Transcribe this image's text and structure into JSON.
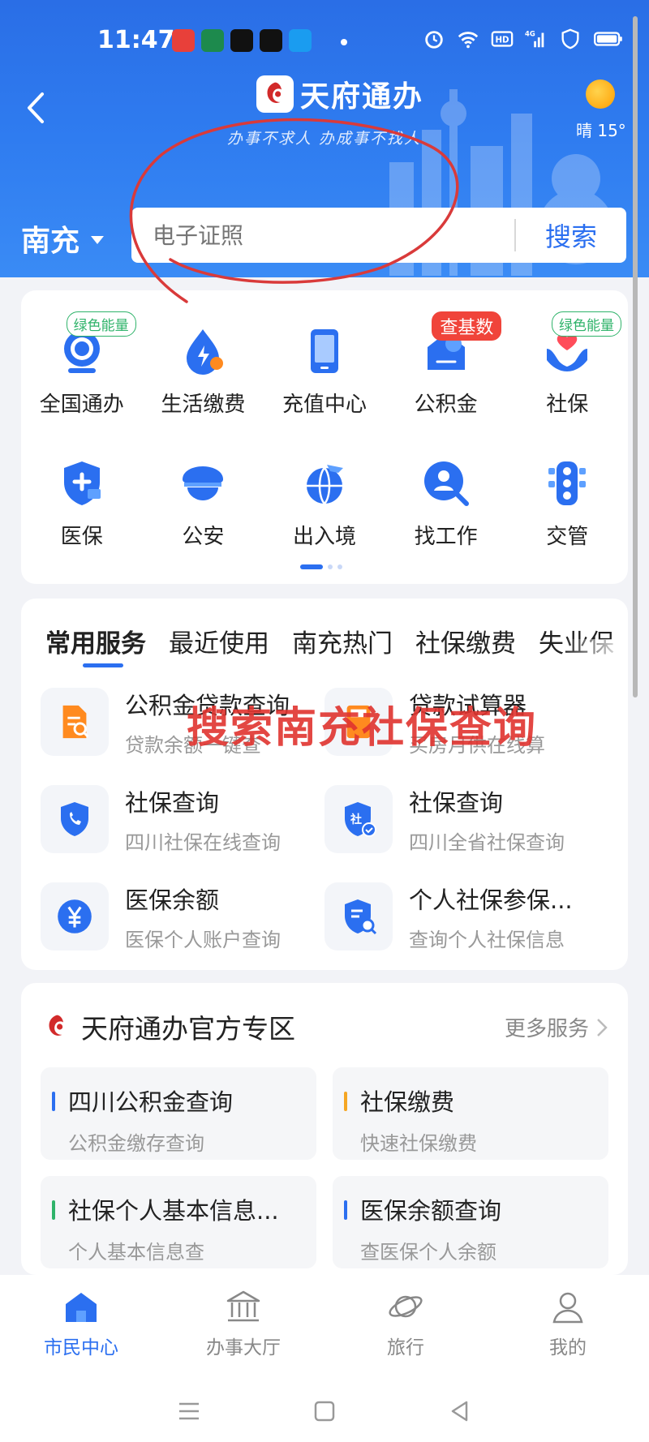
{
  "status_bar": {
    "time": "11:47",
    "network": "4G"
  },
  "header": {
    "logo_text": "天府通办",
    "slogan": "办事不求人 办成事不找人",
    "weather": "晴 15°",
    "city": "南充",
    "search_placeholder": "电子证照",
    "search_button": "搜索"
  },
  "grid": [
    {
      "label": "全国通办",
      "badge": "绿色能量",
      "badge_type": "green",
      "icon": "national-service-icon"
    },
    {
      "label": "生活缴费",
      "badge": "",
      "badge_type": "",
      "icon": "utility-payment-icon"
    },
    {
      "label": "充值中心",
      "badge": "",
      "badge_type": "",
      "icon": "recharge-phone-icon"
    },
    {
      "label": "公积金",
      "badge": "查基数",
      "badge_type": "red",
      "icon": "housing-fund-icon"
    },
    {
      "label": "社保",
      "badge": "绿色能量",
      "badge_type": "green",
      "icon": "social-security-icon"
    },
    {
      "label": "医保",
      "badge": "",
      "badge_type": "",
      "icon": "medical-insurance-icon"
    },
    {
      "label": "公安",
      "badge": "",
      "badge_type": "",
      "icon": "police-icon"
    },
    {
      "label": "出入境",
      "badge": "",
      "badge_type": "",
      "icon": "immigration-icon"
    },
    {
      "label": "找工作",
      "badge": "",
      "badge_type": "",
      "icon": "job-search-icon"
    },
    {
      "label": "交管",
      "badge": "",
      "badge_type": "",
      "icon": "traffic-icon"
    }
  ],
  "services": {
    "tabs": [
      "常用服务",
      "最近使用",
      "南充热门",
      "社保缴费",
      "失业保"
    ],
    "active_tab": 0,
    "items": [
      {
        "title": "公积金贷款查询",
        "sub": "贷款余额一键查",
        "icon": "loan-doc-icon"
      },
      {
        "title": "贷款试算器",
        "sub": "买房月供在线算",
        "icon": "calculator-icon"
      },
      {
        "title": "社保查询",
        "sub": "四川社保在线查询",
        "icon": "shield-phone-icon"
      },
      {
        "title": "社保查询",
        "sub": "四川全省社保查询",
        "icon": "shield-check-icon"
      },
      {
        "title": "医保余额",
        "sub": "医保个人账户查询",
        "icon": "yuan-icon"
      },
      {
        "title": "个人社保参保...",
        "sub": "查询个人社保信息",
        "icon": "shield-search-icon"
      }
    ]
  },
  "zone": {
    "title": "天府通办官方专区",
    "more": "更多服务",
    "items": [
      {
        "title": "四川公积金查询",
        "sub": "公积金缴存查询",
        "color": "#2b6ff0"
      },
      {
        "title": "社保缴费",
        "sub": "快速社保缴费",
        "color": "#f5a623"
      },
      {
        "title": "社保个人基本信息...",
        "sub": "个人基本信息查",
        "color": "#2fb36a"
      },
      {
        "title": "医保余额查询",
        "sub": "查医保个人余额",
        "color": "#2b6ff0"
      }
    ]
  },
  "annotation": {
    "text": "搜索南充社保查询",
    "color": "#e0342f"
  },
  "bottom_nav": [
    {
      "label": "市民中心",
      "active": true,
      "icon": "home-icon"
    },
    {
      "label": "办事大厅",
      "active": false,
      "icon": "hall-icon"
    },
    {
      "label": "旅行",
      "active": false,
      "icon": "travel-planet-icon"
    },
    {
      "label": "我的",
      "active": false,
      "icon": "profile-icon"
    }
  ],
  "colors": {
    "primary": "#2b6ff0",
    "header": "#2f7cf0",
    "orange": "#ff8a1f"
  }
}
